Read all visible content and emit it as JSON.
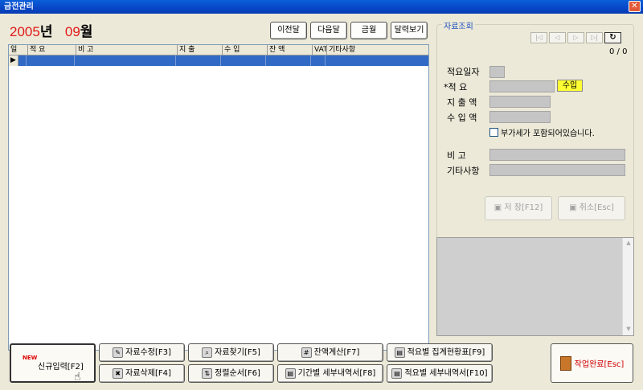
{
  "window": {
    "title": "금전관리",
    "close_glyph": "✕"
  },
  "date": {
    "year": "2005",
    "year_unit": "년",
    "month": "09",
    "month_unit": "월"
  },
  "nav": {
    "prev_month": "이전달",
    "next_month": "다음달",
    "this_month": "금월",
    "calendar": "달력보기"
  },
  "grid": {
    "columns": [
      "일",
      "적 요",
      "비 고",
      "지 출",
      "수 입",
      "잔 액",
      "VAT",
      "기타사항"
    ],
    "row_indicator": "▶"
  },
  "panel": {
    "title": "자료조회",
    "nav_icons": [
      "first-record-icon",
      "prev-record-icon",
      "next-record-icon",
      "last-record-icon",
      "refresh-icon"
    ],
    "record_count": "0 / 0",
    "fields": {
      "date_label": "적요일자",
      "summary_label": "*적      요",
      "income_badge": "수입",
      "expense_label": "지 출 액",
      "income_label": "수 입 액",
      "vat_label": "부가세가 포함되어있습니다.",
      "note_label": "비       고",
      "etc_label": "기타사항"
    },
    "save_label": "저 장[F12]",
    "cancel_label": "취소[Esc]"
  },
  "footer": {
    "new_badge": "NEW",
    "new_entry": "신규입력[F2]",
    "edit": "자료수정[F3]",
    "delete": "자료삭제[F4]",
    "find": "자료찾기[F5]",
    "sort": "정렬순서[F6]",
    "balance": "잔액계산[F7]",
    "period_detail": "기간별 세부내역서[F8]",
    "summary_status": "적요별 집계현황표[F9]",
    "summary_detail": "적요별 세부내역서[F10]",
    "done": "작업완료[Esc]"
  }
}
